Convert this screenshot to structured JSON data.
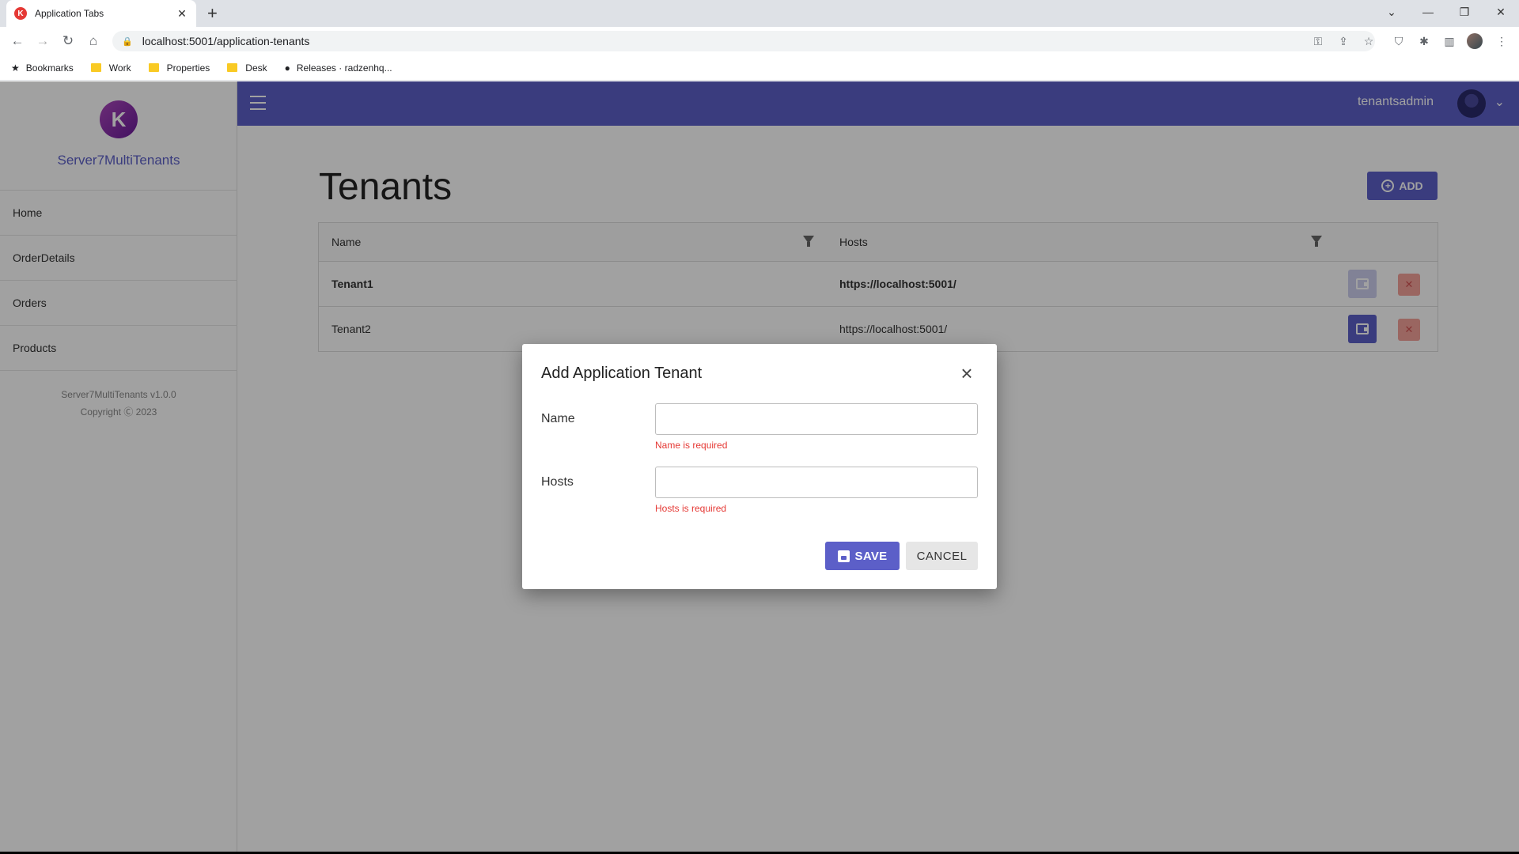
{
  "browser": {
    "tab_title": "Application Tabs",
    "url": "localhost:5001/application-tenants",
    "bookmarks": [
      {
        "label": "Bookmarks",
        "icon": "star-icon"
      },
      {
        "label": "Work",
        "icon": "folder-icon"
      },
      {
        "label": "Properties",
        "icon": "folder-icon"
      },
      {
        "label": "Desk",
        "icon": "folder-icon"
      },
      {
        "label": "Releases · radzenhq...",
        "icon": "github-icon"
      }
    ]
  },
  "app": {
    "name": "Server7MultiTenants",
    "menu": [
      "Home",
      "OrderDetails",
      "Orders",
      "Products"
    ],
    "footer_version": "Server7MultiTenants v1.0.0",
    "footer_copyright": "Copyright Ⓒ 2023",
    "username": "tenantsadmin",
    "brand_color": "#5c5fc8"
  },
  "page": {
    "title": "Tenants",
    "add_label": "ADD",
    "columns": [
      "Name",
      "Hosts"
    ],
    "rows": [
      {
        "name": "Tenant1",
        "hosts": "https://localhost:5001/"
      },
      {
        "name": "Tenant2",
        "hosts": "https://localhost:5001/"
      }
    ]
  },
  "dialog": {
    "title": "Add Application Tenant",
    "name_label": "Name",
    "name_value": "",
    "name_error": "Name is required",
    "hosts_label": "Hosts",
    "hosts_value": "",
    "hosts_error": "Hosts is required",
    "save_label": "SAVE",
    "cancel_label": "CANCEL"
  }
}
